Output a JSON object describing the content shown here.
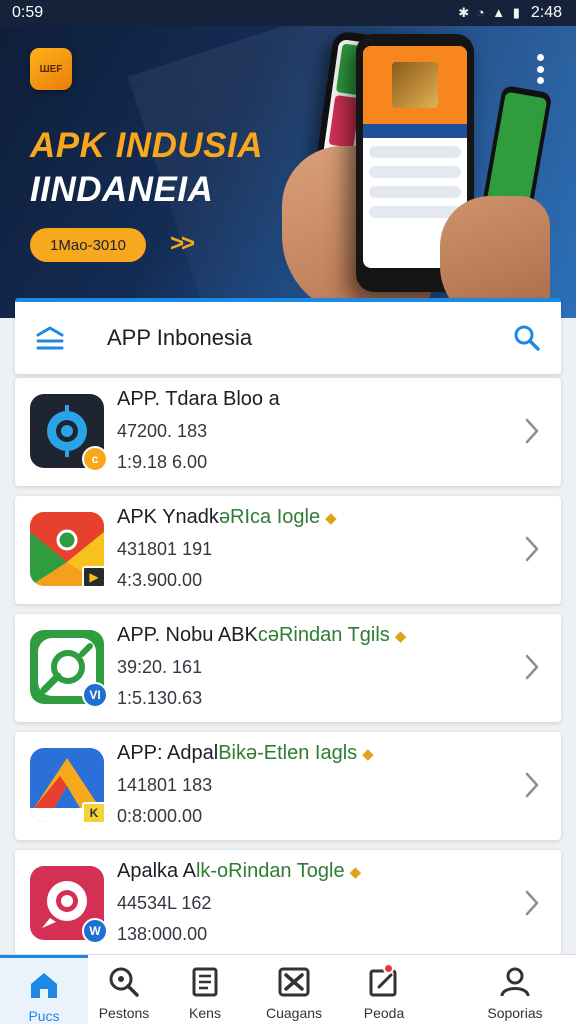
{
  "status_bar": {
    "time_left": "0:59",
    "icons": "✱ ◔ ▲ ▮",
    "time_right": "2:48"
  },
  "banner": {
    "logo_text": "ШЕF",
    "title": "APK INDUSIA",
    "subtitle": "IINDANEIA",
    "date_pill": "1Mao-3010",
    "arrows": ">>"
  },
  "header": {
    "title": "APP Inbonesia"
  },
  "apps": [
    {
      "name": "APP. Tdara Bloo a",
      "name_sub": "",
      "line1": "47200. 183",
      "line2": "1:9.18 6.00",
      "badge": "c",
      "verified": false,
      "icon_color": "#1e2530",
      "badge_color": "#f7a81c"
    },
    {
      "name": "APK Ynadk",
      "name_sub": "əRIca Iogle",
      "line1": "431801 191",
      "line2": "4:3.900.00",
      "badge": "▶",
      "verified": true,
      "icon_color": "#f49f1e",
      "badge_color": "#2a2a2a"
    },
    {
      "name": "APP. Nobu ABK",
      "name_sub": "cəRindan Tgils",
      "line1": "39:20. 161",
      "line2": "1:5.130.63",
      "badge": "VI",
      "verified": true,
      "icon_color": "#2e9c3f",
      "badge_color": "#1e6fd0"
    },
    {
      "name": "APP: Adpal",
      "name_sub": "Bikə-Etlen Iagls",
      "line1": "141801 183",
      "line2": "0:8:000.00",
      "badge": "K",
      "verified": true,
      "icon_color": "#2b6fd8",
      "badge_color": "#f2d33a"
    },
    {
      "name": "Apalka A",
      "name_sub": "lk-oRindan Togle",
      "line1": "44534L 162",
      "line2": "138:000.00",
      "badge": "W",
      "verified": true,
      "icon_color": "#d33053",
      "badge_color": "#1e6fd0"
    }
  ],
  "bottom_nav": [
    {
      "label": "Pucs",
      "icon": "home-icon"
    },
    {
      "label": "Pestons",
      "icon": "search-icon"
    },
    {
      "label": "Kens",
      "icon": "list-icon"
    },
    {
      "label": "Cuagans",
      "icon": "tools-icon"
    },
    {
      "label": "Peoda",
      "icon": "edit-icon"
    },
    {
      "label": "Soporias",
      "icon": "person-icon"
    }
  ],
  "colors": {
    "accent": "#1e88e5",
    "banner_orange": "#f7a81c",
    "banner_bg": "#142c54"
  }
}
